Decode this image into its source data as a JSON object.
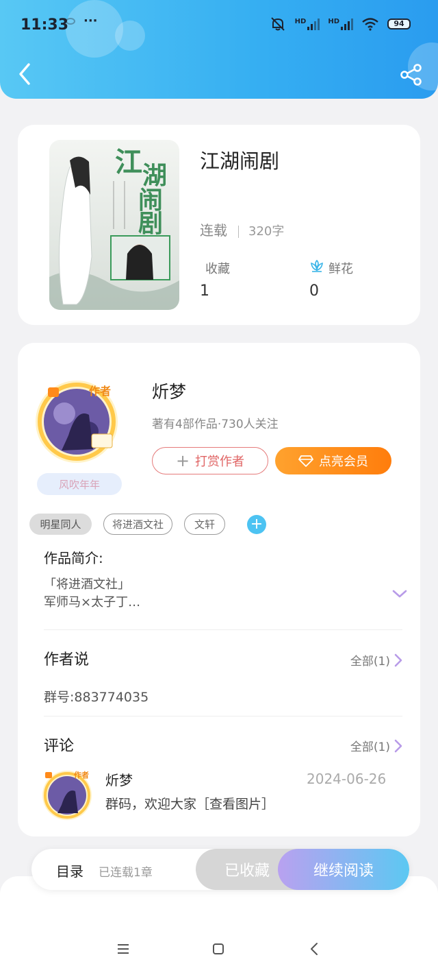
{
  "status_bar": {
    "time": "11:33",
    "dots": "···",
    "hd1": "HD",
    "hd2": "HD",
    "battery": "94"
  },
  "book": {
    "title": "江湖闹剧",
    "status": "连载",
    "words": "320字",
    "favorites_label": "收藏",
    "favorites_value": "1",
    "flowers_label": "鲜花",
    "flowers_value": "0",
    "cover_text": "江湖闹剧"
  },
  "author": {
    "badge": "作者",
    "name": "炘梦",
    "nickname_tag": "风吹年年",
    "info": "著有4部作品·730人关注",
    "tip_button": "打赏作者",
    "vip_button": "点亮会员"
  },
  "tags": [
    "明星同人",
    "将进酒文社",
    "文轩"
  ],
  "intro": {
    "heading": "作品简介:",
    "line1": "「将进酒文社」",
    "line2": "军师马×太子丁…"
  },
  "author_says": {
    "heading": "作者说",
    "more": "全部(1)",
    "text": "群号:883774035"
  },
  "comments": {
    "heading": "评论",
    "more": "全部(1)",
    "items": [
      {
        "name": "炘梦",
        "date": "2024-06-26",
        "text": "群码，欢迎大家［查看图片］"
      }
    ]
  },
  "action_bar": {
    "toc": "目录",
    "toc_sub": "已连载1章",
    "collected": "已收藏",
    "continue": "继续阅读"
  },
  "colors": {
    "header": "#35aef2",
    "accent_orange": "#ff8a1a",
    "tip_red": "#e06565",
    "purple_arrow": "#b89be8",
    "tag_add": "#4dc3f2"
  }
}
